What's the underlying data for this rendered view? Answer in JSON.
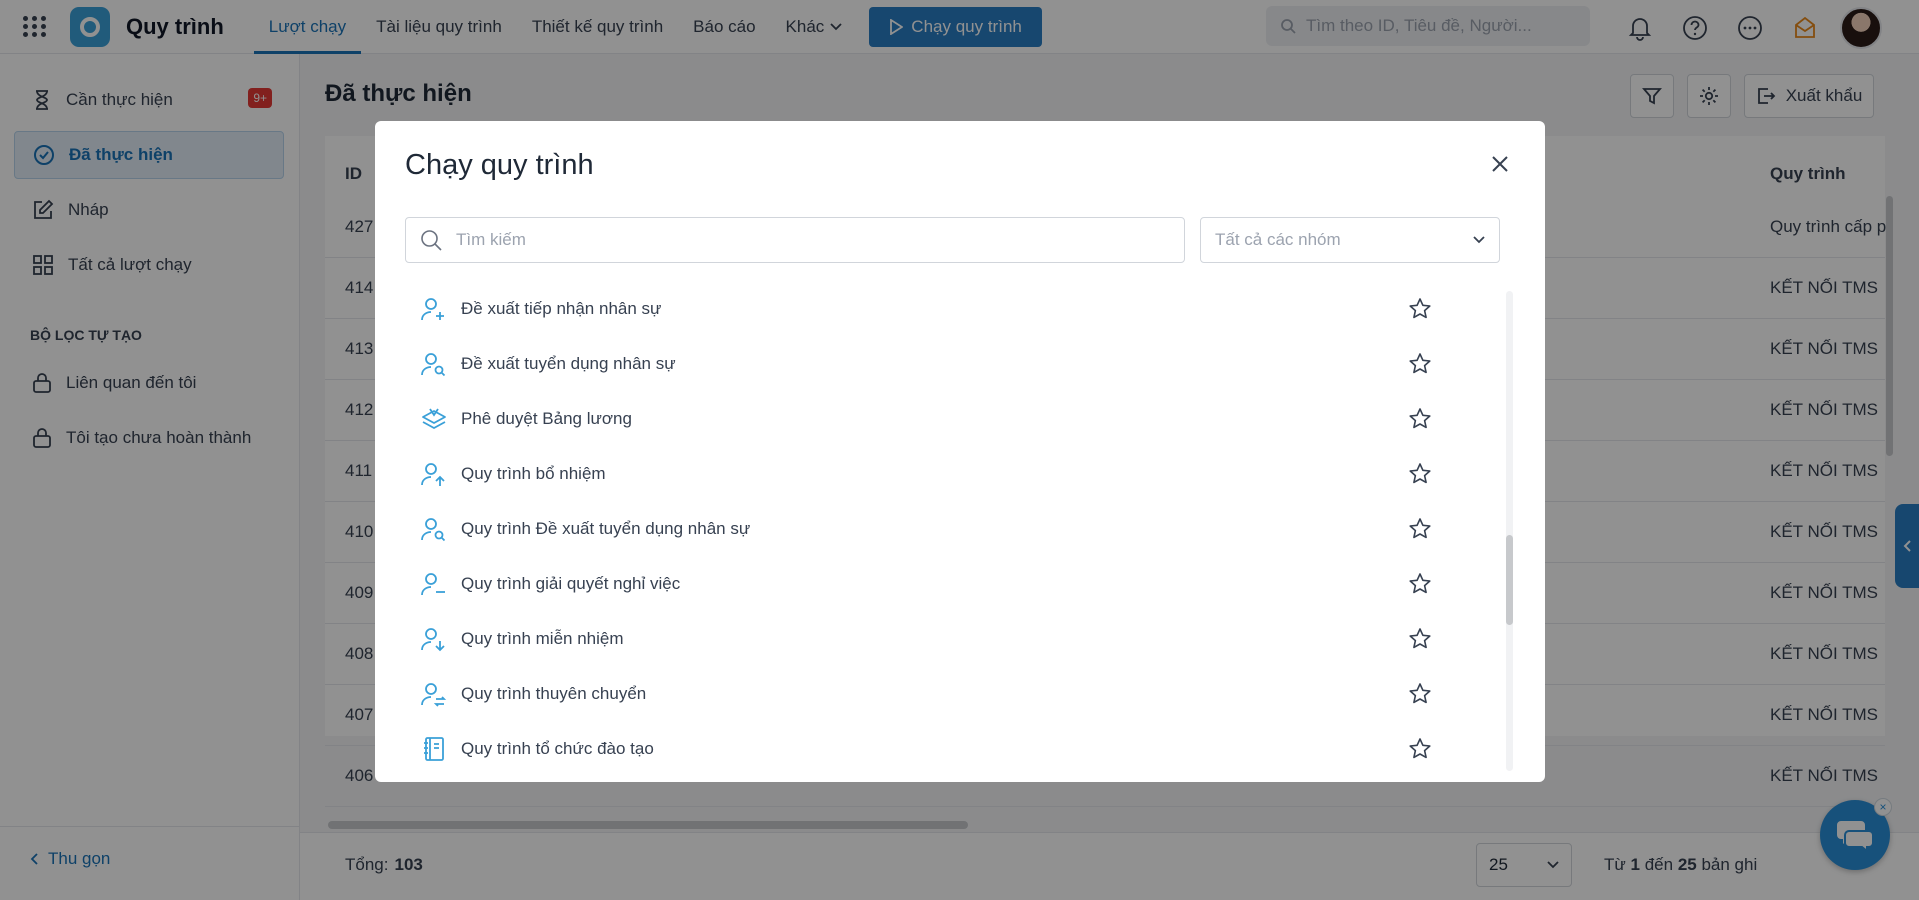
{
  "app": {
    "title": "Quy trình"
  },
  "nav": {
    "items": [
      "Lượt chạy",
      "Tài liệu quy trình",
      "Thiết kế quy trình",
      "Báo cáo"
    ],
    "more": "Khác",
    "run_button": "Chạy quy trình"
  },
  "search": {
    "placeholder": "Tìm theo ID, Tiêu đề, Người..."
  },
  "sidebar": {
    "items": [
      {
        "label": "Cần thực hiện",
        "badge": "9+"
      },
      {
        "label": "Đã thực hiện"
      },
      {
        "label": "Nháp"
      },
      {
        "label": "Tất cả lượt chạy"
      }
    ],
    "section": "BỘ LỌC TỰ TẠO",
    "filters": [
      "Liên quan đến tôi",
      "Tôi tạo chưa hoàn thành"
    ],
    "collapse": "Thu gọn"
  },
  "main": {
    "title": "Đã thực hiện",
    "export": "Xuất khẩu",
    "columns": {
      "id": "ID",
      "process": "Quy trình"
    },
    "rows": [
      {
        "id": "427",
        "process": "Quy trình cấp p"
      },
      {
        "id": "414",
        "process": "KẾT NỐI TMS"
      },
      {
        "id": "413",
        "process": "KẾT NỐI TMS"
      },
      {
        "id": "412",
        "process": "KẾT NỐI TMS"
      },
      {
        "id": "411",
        "process": "KẾT NỐI TMS"
      },
      {
        "id": "410",
        "process": "KẾT NỐI TMS"
      },
      {
        "id": "409",
        "process": "KẾT NỐI TMS"
      },
      {
        "id": "408",
        "process": "KẾT NỐI TMS"
      },
      {
        "id": "407",
        "process": "KẾT NỐI TMS"
      },
      {
        "id": "406",
        "process": "KẾT NỐI TMS"
      }
    ]
  },
  "footer": {
    "total_label": "Tổng:",
    "total_value": "103",
    "per_page": "25",
    "range_from_label": "Từ",
    "range_from": "1",
    "range_to_label": "đến",
    "range_to": "25",
    "range_suffix": "bản ghi"
  },
  "modal": {
    "title": "Chạy quy trình",
    "search_placeholder": "Tìm kiếm",
    "group_select": "Tất cả các nhóm",
    "items": [
      {
        "label": "Đề xuất tiếp nhận nhân sự",
        "icon": "user-plus-icon"
      },
      {
        "label": "Đề xuất tuyển dụng nhân sự",
        "icon": "user-search-icon"
      },
      {
        "label": "Phê duyệt Bảng lương",
        "icon": "payroll-icon"
      },
      {
        "label": "Quy trình bổ nhiệm",
        "icon": "user-up-icon"
      },
      {
        "label": "Quy trình Đề xuất tuyển dụng nhân sự",
        "icon": "user-search-icon"
      },
      {
        "label": "Quy trình giải quyết nghỉ việc",
        "icon": "user-minus-icon"
      },
      {
        "label": "Quy trình miễn nhiệm",
        "icon": "user-down-icon"
      },
      {
        "label": "Quy trình thuyên chuyển",
        "icon": "user-transfer-icon"
      },
      {
        "label": "Quy trình tổ chức đào tạo",
        "icon": "book-icon"
      }
    ]
  },
  "colors": {
    "accent": "#2a7ec4",
    "icon_blue": "#3aa0d8",
    "badge": "#e53935"
  }
}
